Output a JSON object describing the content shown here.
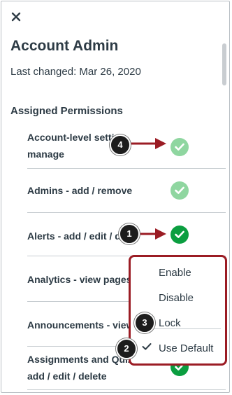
{
  "header": {
    "close_icon": "close-icon",
    "title": "Account Admin",
    "last_changed": "Last changed: Mar 26, 2020"
  },
  "section_title": "Assigned Permissions",
  "permissions": [
    {
      "label_line1": "Account-level setti",
      "label_line2": "manage",
      "status": "enabled-light"
    },
    {
      "label_line1": "Admins - add / remove",
      "status": "enabled-light"
    },
    {
      "label_line1": "Alerts - add / edit / de",
      "status": "enabled-dark"
    },
    {
      "label_line1": "Analytics - view pages",
      "status": "enabled-dark"
    },
    {
      "label_line1": "Announcements - view",
      "status": "enabled-dark"
    },
    {
      "label_line1": "Assignments and Quiz",
      "label_line2": "add / edit / delete",
      "status": "enabled-dark"
    }
  ],
  "menu": {
    "items": [
      "Enable",
      "Disable",
      "Lock",
      "Use Default"
    ],
    "checked": "Use Default"
  },
  "callouts": [
    "1",
    "2",
    "3",
    "4"
  ],
  "colors": {
    "text": "#2d3b45",
    "green_light": "#8fd6a0",
    "green_dark": "#0b9e40",
    "callout_arrow": "#9b1c24",
    "menu_border": "#9b1c24"
  }
}
